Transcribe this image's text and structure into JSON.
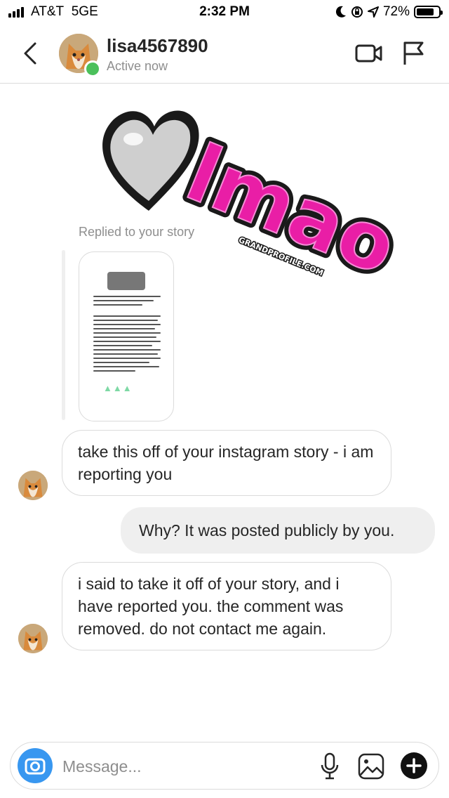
{
  "status_bar": {
    "carrier": "AT&T",
    "network": "5GE",
    "time": "2:32 PM",
    "battery": "72%",
    "icons": [
      "signal-icon",
      "moon-icon",
      "orientation-lock-icon",
      "location-icon",
      "battery-icon"
    ]
  },
  "header": {
    "username": "lisa4567890",
    "presence": "Active now",
    "icons": [
      "back-chevron-icon",
      "video-call-icon",
      "flag-icon"
    ]
  },
  "thread": {
    "story_reply_label": "Replied to your story",
    "sticker": {
      "text": "lmao",
      "watermark": "GRANDPROFILE.COM",
      "colors": {
        "text": "#e91ea6",
        "heart": "#cfcfcf",
        "outline": "#1a1a1a"
      }
    },
    "messages": [
      {
        "side": "incoming",
        "text": "take this off of your instagram story - i am reporting you"
      },
      {
        "side": "outgoing",
        "text": "Why? It was posted publicly by you."
      },
      {
        "side": "incoming",
        "text": "i said to take it off of your story, and i have reported you. the comment was removed. do not contact me again."
      }
    ]
  },
  "composer": {
    "placeholder": "Message...",
    "icons": [
      "camera-icon",
      "microphone-icon",
      "gallery-icon",
      "add-icon"
    ]
  },
  "colors": {
    "accent": "#3897f0",
    "online": "#4bc05b",
    "bubble_outgoing": "#efefef",
    "bubble_border": "#dbdbdb",
    "secondary_text": "#8e8e8e"
  }
}
